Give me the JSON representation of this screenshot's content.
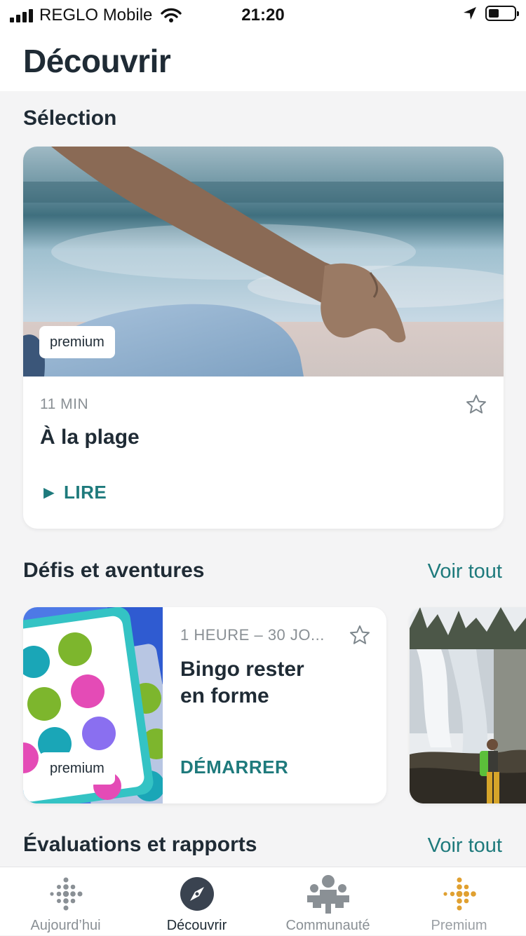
{
  "status_bar": {
    "carrier": "REGLO Mobile",
    "time": "21:20"
  },
  "header": {
    "title": "Découvrir"
  },
  "featured_section": {
    "title": "Sélection",
    "card": {
      "badge": "premium",
      "duration": "11 MIN",
      "title": "À la plage",
      "action": "► LIRE"
    }
  },
  "challenges_section": {
    "title": "Défis et aventures",
    "see_all": "Voir tout",
    "card": {
      "badge": "premium",
      "duration": "1 HEURE – 30 JO...",
      "title_line1": "Bingo rester",
      "title_line2": "en forme",
      "action": "DÉMARRER"
    }
  },
  "reports_section": {
    "title": "Évaluations et rapports",
    "see_all": "Voir tout"
  },
  "tab_bar": {
    "tabs": [
      {
        "label": "Aujourd’hui",
        "icon": "fitbit-dots-icon"
      },
      {
        "label": "Découvrir",
        "icon": "compass-icon"
      },
      {
        "label": "Communauté",
        "icon": "community-icon"
      },
      {
        "label": "Premium",
        "icon": "premium-dots-icon"
      }
    ],
    "active_tab": "Découvrir"
  },
  "colors": {
    "accent": "#1e7a7c",
    "text": "#1f2b35",
    "muted": "#8a9095",
    "premium": "#e0a030"
  }
}
